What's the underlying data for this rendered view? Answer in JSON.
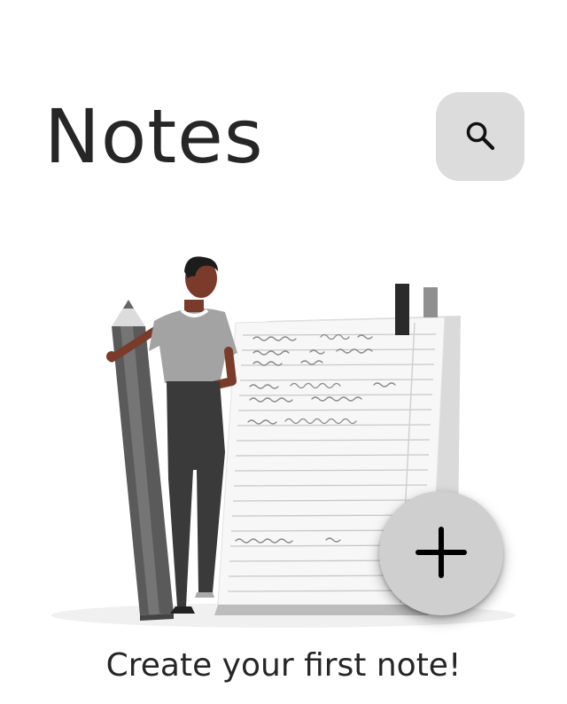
{
  "header": {
    "title": "Notes",
    "search_icon": "search-icon"
  },
  "empty_state": {
    "illustration": "person-with-pencil-and-notepad-illustration",
    "message": "Create your first note!"
  },
  "fab": {
    "icon": "plus-icon"
  },
  "colors": {
    "background": "#ffffff",
    "text": "#262626",
    "search_button_bg": "#dcdcdc",
    "fab_bg": "#cfcfcf"
  }
}
